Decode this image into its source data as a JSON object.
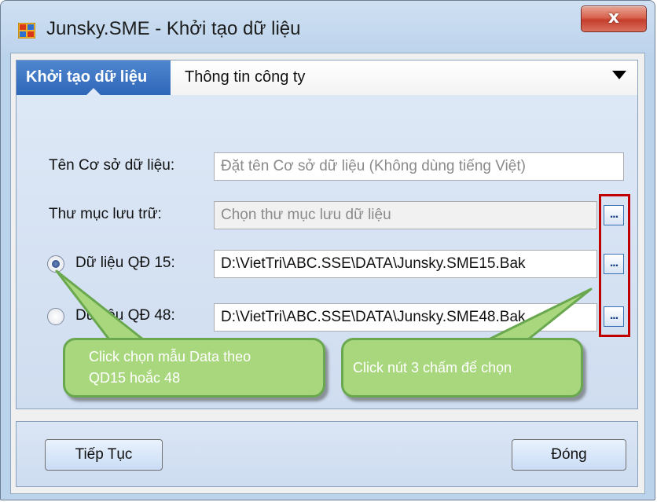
{
  "window": {
    "title": "Junsky.SME - Khởi tạo dữ liệu",
    "close_label": "x"
  },
  "tabs": [
    {
      "label": "Khởi tạo dữ liệu",
      "active": true
    },
    {
      "label": "Thông tin công ty",
      "active": false
    }
  ],
  "form": {
    "db_name_label": "Tên Cơ sở dữ liệu:",
    "db_name_placeholder": "Đặt tên Cơ sở dữ liệu (Không dùng tiếng Việt)",
    "folder_label": "Thư mục lưu trữ:",
    "folder_placeholder": "Chọn thư mục lưu dữ liệu",
    "qd15_label": "Dữ liệu QĐ 15:",
    "qd15_value": "D:\\VietTri\\ABC.SSE\\DATA\\Junsky.SME15.Bak",
    "qd15_checked": true,
    "qd48_label": "Dữ liệu QĐ 48:",
    "qd48_value": "D:\\VietTri\\ABC.SSE\\DATA\\Junsky.SME48.Bak",
    "qd48_checked": false,
    "browse_label": "..."
  },
  "callouts": {
    "left_line1": "Click chọn mẫu Data theo",
    "left_line2": "QD15 hoắc 48",
    "right": "Click nút 3 chấm để chọn"
  },
  "buttons": {
    "continue": "Tiếp Tục",
    "close": "Đóng"
  },
  "colors": {
    "highlight": "#c00000",
    "callout_fill": "#a9d77e",
    "tab_active": "#3a72c0"
  }
}
